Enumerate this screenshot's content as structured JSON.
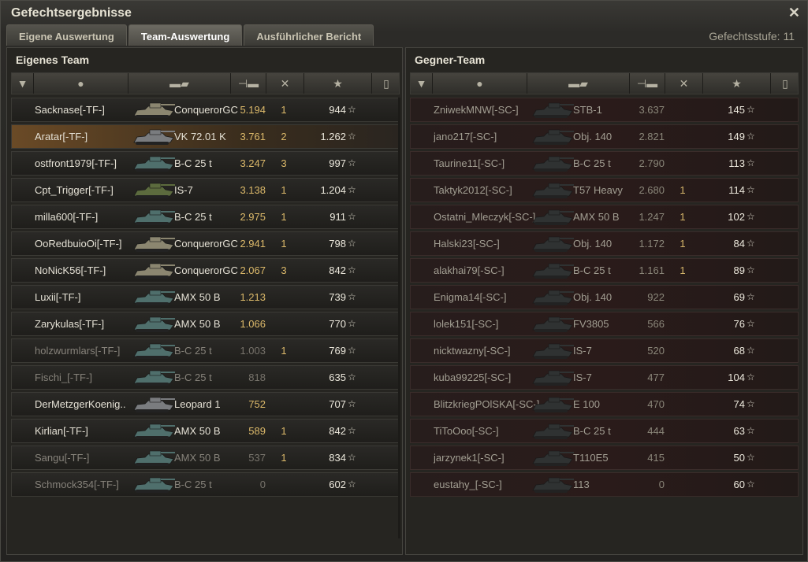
{
  "window": {
    "title": "Gefechtsergebnisse",
    "level": "Gefechtsstufe: 11"
  },
  "tabs": [
    "Eigene Auswertung",
    "Team-Auswertung",
    "Ausführlicher Bericht"
  ],
  "left_team": {
    "title": "Eigenes Team",
    "rows": [
      {
        "name": "Sacknase[-TF-]",
        "vehicle": "ConquerorGC",
        "damage": "5.194",
        "kills": "1",
        "xp": "944",
        "state": "normal",
        "tank": "khaki"
      },
      {
        "name": "Aratar[-TF-]",
        "vehicle": "VK 72.01 K",
        "damage": "3.761",
        "kills": "2",
        "xp": "1.262",
        "state": "highlight",
        "tank": "grey"
      },
      {
        "name": "ostfront1979[-TF-]",
        "vehicle": "B-C 25 t",
        "damage": "3.247",
        "kills": "3",
        "xp": "997",
        "state": "normal",
        "tank": "teal"
      },
      {
        "name": "Cpt_Trigger[-TF-]",
        "vehicle": "IS-7",
        "damage": "3.138",
        "kills": "1",
        "xp": "1.204",
        "state": "normal",
        "tank": "green"
      },
      {
        "name": "milla600[-TF-]",
        "vehicle": "B-C 25 t",
        "damage": "2.975",
        "kills": "1",
        "xp": "911",
        "state": "normal",
        "tank": "teal"
      },
      {
        "name": "OoRedbuioOi[-TF-]",
        "vehicle": "ConquerorGC",
        "damage": "2.941",
        "kills": "1",
        "xp": "798",
        "state": "normal",
        "tank": "khaki"
      },
      {
        "name": "NoNicK56[-TF-]",
        "vehicle": "ConquerorGC",
        "damage": "2.067",
        "kills": "3",
        "xp": "842",
        "state": "normal",
        "tank": "khaki"
      },
      {
        "name": "Luxii[-TF-]",
        "vehicle": "AMX 50 B",
        "damage": "1.213",
        "kills": "",
        "xp": "739",
        "state": "normal",
        "tank": "teal"
      },
      {
        "name": "Zarykulas[-TF-]",
        "vehicle": "AMX 50 B",
        "damage": "1.066",
        "kills": "",
        "xp": "770",
        "state": "normal",
        "tank": "teal"
      },
      {
        "name": "holzwurmlars[-TF-]",
        "vehicle": "B-C 25 t",
        "damage": "1.003",
        "kills": "1",
        "xp": "769",
        "state": "dead",
        "tank": "teal"
      },
      {
        "name": "Fischi_[-TF-]",
        "vehicle": "B-C 25 t",
        "damage": "818",
        "kills": "",
        "xp": "635",
        "state": "dead",
        "tank": "teal"
      },
      {
        "name": "DerMetzgerKoenig..",
        "vehicle": "Leopard 1",
        "damage": "752",
        "kills": "",
        "xp": "707",
        "state": "normal",
        "tank": "grey"
      },
      {
        "name": "Kirlian[-TF-]",
        "vehicle": "AMX 50 B",
        "damage": "589",
        "kills": "1",
        "xp": "842",
        "state": "normal",
        "tank": "teal"
      },
      {
        "name": "Sangu[-TF-]",
        "vehicle": "AMX 50 B",
        "damage": "537",
        "kills": "1",
        "xp": "834",
        "state": "dead",
        "tank": "teal"
      },
      {
        "name": "Schmock354[-TF-]",
        "vehicle": "B-C 25 t",
        "damage": "0",
        "kills": "",
        "xp": "602",
        "state": "dead",
        "tank": "teal"
      }
    ]
  },
  "right_team": {
    "title": "Gegner-Team",
    "rows": [
      {
        "name": "ZniwekMNW[-SC-]",
        "vehicle": "STB-1",
        "damage": "3.637",
        "kills": "",
        "xp": "145",
        "tank": "dark"
      },
      {
        "name": "jano217[-SC-]",
        "vehicle": "Obj. 140",
        "damage": "2.821",
        "kills": "",
        "xp": "149",
        "tank": "dark"
      },
      {
        "name": "Taurine11[-SC-]",
        "vehicle": "B-C 25 t",
        "damage": "2.790",
        "kills": "",
        "xp": "113",
        "tank": "dark"
      },
      {
        "name": "Taktyk2012[-SC-]",
        "vehicle": "T57 Heavy",
        "damage": "2.680",
        "kills": "1",
        "xp": "114",
        "tank": "dark"
      },
      {
        "name": "Ostatni_Mleczyk[-SC-]",
        "vehicle": "AMX 50 B",
        "damage": "1.247",
        "kills": "1",
        "xp": "102",
        "tank": "dark"
      },
      {
        "name": "Halski23[-SC-]",
        "vehicle": "Obj. 140",
        "damage": "1.172",
        "kills": "1",
        "xp": "84",
        "tank": "dark"
      },
      {
        "name": "alakhai79[-SC-]",
        "vehicle": "B-C 25 t",
        "damage": "1.161",
        "kills": "1",
        "xp": "89",
        "tank": "dark"
      },
      {
        "name": "Enigma14[-SC-]",
        "vehicle": "Obj. 140",
        "damage": "922",
        "kills": "",
        "xp": "69",
        "tank": "dark"
      },
      {
        "name": "lolek151[-SC-]",
        "vehicle": "FV3805",
        "damage": "566",
        "kills": "",
        "xp": "76",
        "tank": "dark"
      },
      {
        "name": "nicktwazny[-SC-]",
        "vehicle": "IS-7",
        "damage": "520",
        "kills": "",
        "xp": "68",
        "tank": "dark"
      },
      {
        "name": "kuba99225[-SC-]",
        "vehicle": "IS-7",
        "damage": "477",
        "kills": "",
        "xp": "104",
        "tank": "dark"
      },
      {
        "name": "BlitzkriegPOlSKA[-SC-]",
        "vehicle": "E 100",
        "damage": "470",
        "kills": "",
        "xp": "74",
        "tank": "dark"
      },
      {
        "name": "TiToOoo[-SC-]",
        "vehicle": "B-C 25 t",
        "damage": "444",
        "kills": "",
        "xp": "63",
        "tank": "dark"
      },
      {
        "name": "jarzynek1[-SC-]",
        "vehicle": "T110E5",
        "damage": "415",
        "kills": "",
        "xp": "50",
        "tank": "dark"
      },
      {
        "name": "eustahy_[-SC-]",
        "vehicle": "113",
        "damage": "0",
        "kills": "",
        "xp": "60",
        "tank": "dark"
      }
    ]
  },
  "icons": {
    "close": "close-icon",
    "rank": "rank-icon",
    "player": "player-icon",
    "tank": "tank-icon",
    "damage": "damage-icon",
    "kills": "kills-icon",
    "xp": "star-icon",
    "medal": "medal-icon"
  },
  "colors": {
    "damage": "#dcb96a",
    "highlight": "#6a4a26",
    "enemy_row": "#2a1b1a"
  }
}
